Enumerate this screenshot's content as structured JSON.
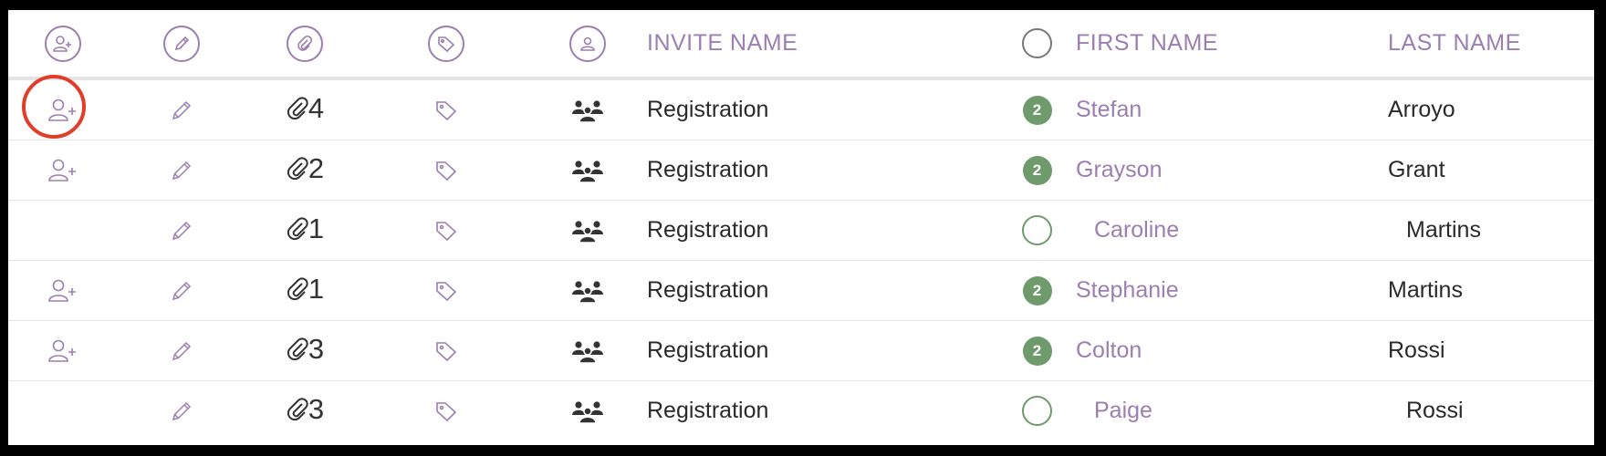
{
  "header": {
    "add_user_icon": "person-add-icon",
    "edit_icon": "pencil-icon",
    "attachment_icon": "paperclip-icon",
    "tag_icon": "tag-icon",
    "group_icon": "person-icon",
    "invite_name": "INVITE NAME",
    "status_icon": "circle-icon",
    "first_name": "FIRST NAME",
    "last_name": "LAST NAME"
  },
  "rows": [
    {
      "has_add_user": true,
      "attachments": "4",
      "invite_name": "Registration",
      "status": "2",
      "first_name": "Stefan",
      "last_name": "Arroyo",
      "highlighted": true
    },
    {
      "has_add_user": true,
      "attachments": "2",
      "invite_name": "Registration",
      "status": "2",
      "first_name": "Grayson",
      "last_name": "Grant"
    },
    {
      "has_add_user": false,
      "attachments": "1",
      "invite_name": "Registration",
      "status": "",
      "first_name": "Caroline",
      "last_name": "Martins"
    },
    {
      "has_add_user": true,
      "attachments": "1",
      "invite_name": "Registration",
      "status": "2",
      "first_name": "Stephanie",
      "last_name": "Martins"
    },
    {
      "has_add_user": true,
      "attachments": "3",
      "invite_name": "Registration",
      "status": "2",
      "first_name": "Colton",
      "last_name": "Rossi"
    },
    {
      "has_add_user": false,
      "attachments": "3",
      "invite_name": "Registration",
      "status": "",
      "first_name": "Paige",
      "last_name": "Rossi"
    }
  ],
  "colors": {
    "accent_purple": "#9b7fb1",
    "badge_green": "#6f9a6c",
    "highlight_red": "#e03e2a",
    "text_dark": "#2a2a2a"
  }
}
